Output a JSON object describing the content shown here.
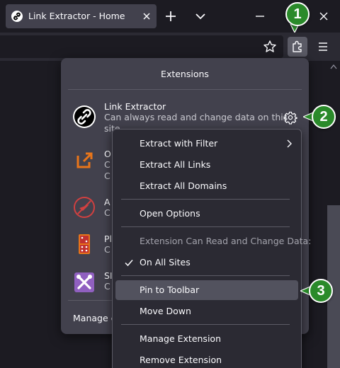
{
  "browser": {
    "tab_title": "Link Extractor - Home",
    "new_tab_icon": "plus-icon",
    "tab_list_icon": "chevron-down-icon",
    "window_controls": [
      "minimize-icon",
      "maximize-icon",
      "close-icon"
    ]
  },
  "toolbar": {
    "bookmark_icon": "star-icon",
    "extensions_icon": "puzzle-icon",
    "menu_icon": "hamburger-icon"
  },
  "panel": {
    "title": "Extensions",
    "extensions": [
      {
        "name": "Link Extractor",
        "desc_line1": "Can always read and change data on this",
        "desc_line2": "site",
        "icon": "link-icon"
      },
      {
        "name": "O",
        "desc_line1": "C",
        "desc_line2": "C",
        "icon": "open-external-icon"
      },
      {
        "name": "A",
        "desc_line1": "C",
        "icon": "airplane-icon"
      },
      {
        "name": "Pl",
        "desc_line1": "C",
        "icon": "dice-icon"
      },
      {
        "name": "SI",
        "desc_line1": "C",
        "icon": "tools-icon"
      }
    ],
    "manage_label": "Manage ex"
  },
  "context_menu": {
    "items": [
      {
        "label": "Extract with Filter",
        "submenu": true
      },
      {
        "label": "Extract All Links"
      },
      {
        "label": "Extract All Domains"
      },
      {
        "label": "Open Options"
      },
      {
        "label": "Extension Can Read and Change Data:",
        "disabled": true
      },
      {
        "label": "On All Sites",
        "checked": true
      },
      {
        "label": "Pin to Toolbar",
        "hover": true
      },
      {
        "label": "Move Down"
      },
      {
        "label": "Manage Extension"
      },
      {
        "label": "Remove Extension"
      }
    ]
  },
  "callouts": [
    "1",
    "2",
    "3"
  ],
  "colors": {
    "callout_green": "#2a8a2a",
    "menu_bg": "#2b2a33",
    "panel_bg": "#42414d",
    "hover_bg": "#52525e",
    "orange_icon": "#e8751a",
    "purple_icon": "#9060c0",
    "red_icon": "#d04040"
  }
}
